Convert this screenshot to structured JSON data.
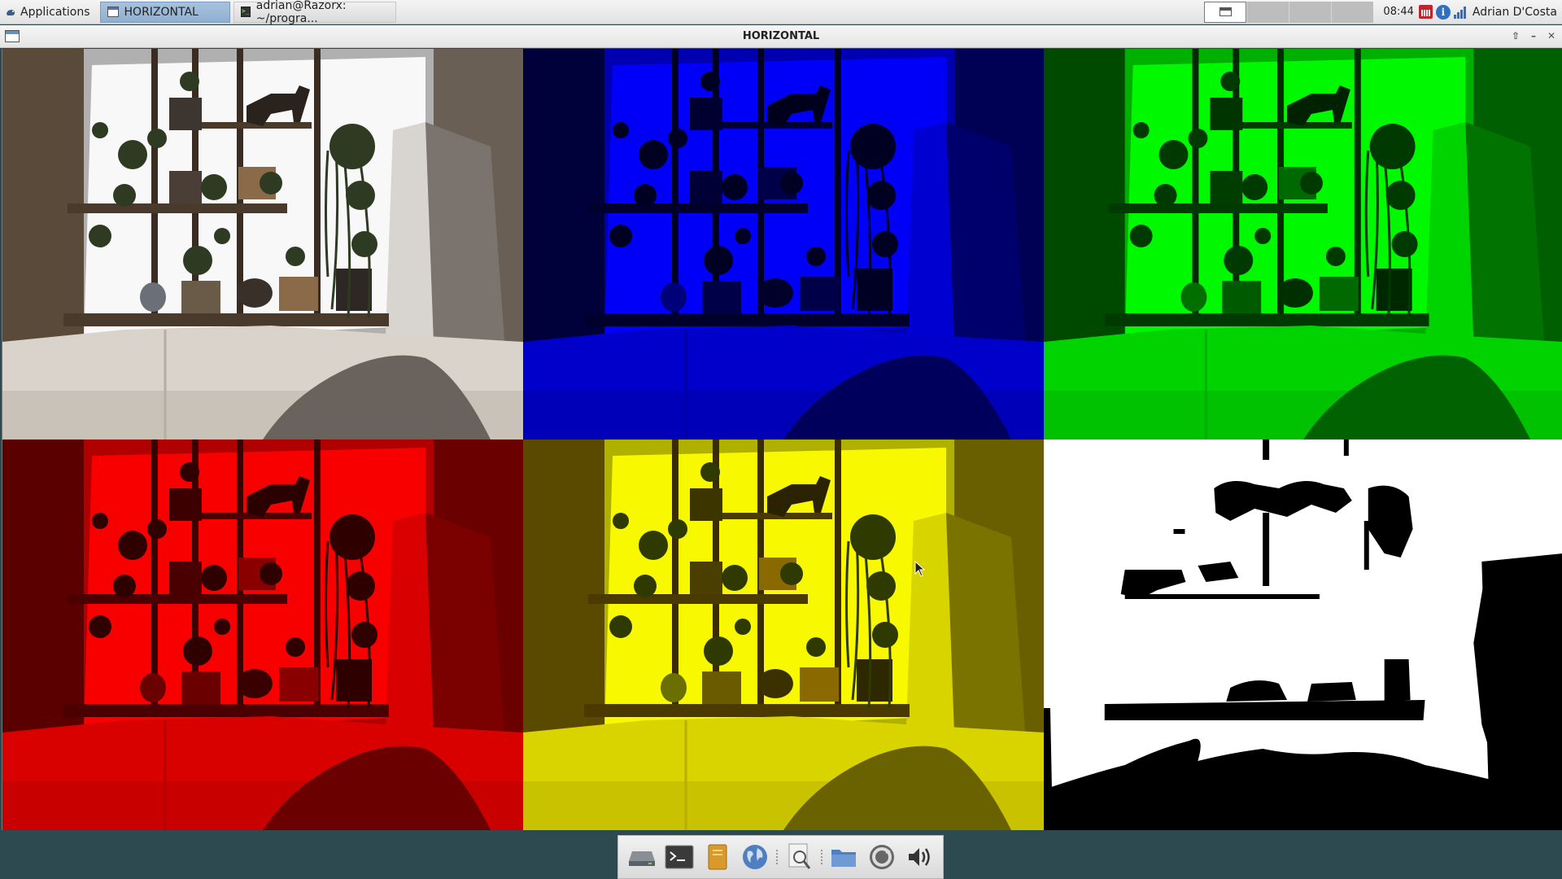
{
  "panel": {
    "applications_label": "Applications",
    "tasks": [
      {
        "label": "HORIZONTAL",
        "active": true
      },
      {
        "label": "adrian@Razorx: ~/progra...",
        "active": false
      }
    ],
    "clock": "08:44",
    "user": "Adrian D'Costa",
    "workspace_count": 4,
    "current_workspace": 1
  },
  "window": {
    "title": "HORIZONTAL"
  },
  "video_grid": {
    "panels": [
      {
        "name": "original",
        "tint": "none"
      },
      {
        "name": "blue-channel",
        "tint": "#0000ff"
      },
      {
        "name": "green-channel",
        "tint": "#00ff00"
      },
      {
        "name": "red-channel",
        "tint": "#ff0000"
      },
      {
        "name": "yellow-tint",
        "tint": "#ffff00"
      },
      {
        "name": "threshold",
        "tint": "binary"
      }
    ]
  },
  "dock": {
    "items": [
      {
        "icon": "drive-icon"
      },
      {
        "icon": "terminal-icon"
      },
      {
        "icon": "notes-icon"
      },
      {
        "icon": "web-browser-icon"
      },
      {
        "icon": "search-icon"
      },
      {
        "icon": "folder-icon"
      },
      {
        "icon": "update-icon"
      },
      {
        "icon": "volume-icon"
      }
    ]
  }
}
